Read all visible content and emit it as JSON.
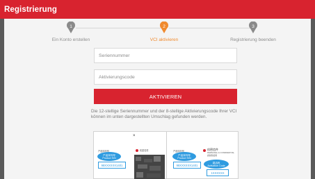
{
  "header": {
    "title": "Registrierung"
  },
  "steps": [
    {
      "number": "1",
      "label": "Ein Konto erstellen",
      "state": "done",
      "color": "#8a8a8a"
    },
    {
      "number": "2",
      "label": "VCI aktivieren",
      "state": "active",
      "color": "#f08a2e"
    },
    {
      "number": "3",
      "label": "Registrierung beenden",
      "state": "todo",
      "color": "#8a8a8a"
    }
  ],
  "form": {
    "serial_placeholder": "Seriennummer",
    "activation_placeholder": "Aktivierungscode",
    "activate_label": "AKTIVIEREN",
    "hint": "Die 12-stellige Seriennummer und der 8-stellige Aktivierungscode Ihrer VCI können im unten dargestellten Umschlag gefunden werden."
  },
  "envelope": {
    "left": {
      "cn_title": "产品序列号",
      "bubble_cn": "产品序列号",
      "bubble_en": "Product S/N",
      "code": "98XXXXXX1401",
      "cross": "×"
    },
    "right": {
      "brand_cn": "机密信件",
      "brand_en": "PERSONAL & CONFIDENTIAL",
      "sub_cn": "感谢您使用",
      "cn_title": "产品序列号",
      "bubble_cn": "产品序列号",
      "bubble_en": "Product S/N",
      "code": "98XXXXXX1401",
      "bubble2_cn": "激活码",
      "bubble2_en": "Activation Code",
      "code2": "1XXXXXX"
    }
  },
  "colors": {
    "accent": "#d8232f",
    "active_step": "#f08a2e",
    "info_blue": "#2f9be0"
  }
}
